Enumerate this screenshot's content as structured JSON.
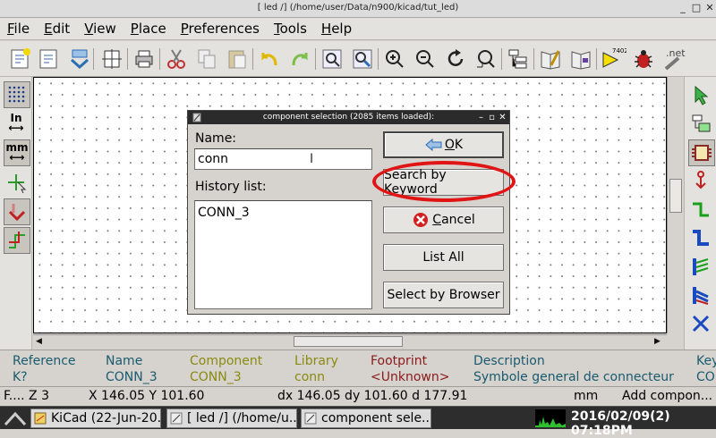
{
  "window": {
    "title": "[ led /] (/home/user/Data/n900/kicad/tut_led)"
  },
  "menubar": [
    {
      "label": "File",
      "mnemonic": "F",
      "rest": "ile"
    },
    {
      "label": "Edit",
      "mnemonic": "E",
      "rest": "dit"
    },
    {
      "label": "View",
      "mnemonic": "V",
      "rest": "iew"
    },
    {
      "label": "Place",
      "mnemonic": "P",
      "rest": "lace"
    },
    {
      "label": "Preferences",
      "mnemonic": "P",
      "rest": "references"
    },
    {
      "label": "Tools",
      "mnemonic": "T",
      "rest": "ools"
    },
    {
      "label": "Help",
      "mnemonic": "H",
      "rest": "elp"
    }
  ],
  "toolbar": {
    "bom_label": "7402",
    "net_label": ".net"
  },
  "left_toolbar": {
    "units_in": "In",
    "units_mm": "mm"
  },
  "dialog": {
    "title": "component selection (2085 items loaded):",
    "name_label": "Name:",
    "name_value": "conn",
    "history_label": "History list:",
    "history_items": [
      "CONN_3"
    ],
    "buttons": {
      "ok": {
        "mnemonic": "O",
        "rest": "K"
      },
      "search_keyword": "Search by Keyword",
      "cancel": {
        "mnemonic": "C",
        "rest": "ancel"
      },
      "list_all": "List All",
      "select_browser": "Select by Browser"
    }
  },
  "message_panel": [
    {
      "header": "Reference",
      "value": "K?",
      "color": "#1a5a6e"
    },
    {
      "header": "Name",
      "value": "CONN_3",
      "color": "#1a5a6e"
    },
    {
      "header": "Component",
      "value": "CONN_3",
      "color": "#8a8a10"
    },
    {
      "header": "Library",
      "value": "conn",
      "color": "#8a8a10"
    },
    {
      "header": "Footprint",
      "value": "<Unknown>",
      "color": "#8a1a1a"
    },
    {
      "header": "Description",
      "value": "Symbole general de connecteur",
      "color": "#1a5a6e"
    },
    {
      "header": "Key",
      "value": "CO",
      "color": "#1a5a6e"
    }
  ],
  "statusbar": {
    "zoom": "F.... Z 3",
    "xy": "X 146.05  Y 101.60",
    "delta": "dx 146.05  dy 101.60  d 177.91",
    "units": "mm",
    "mode": "Add compon..."
  },
  "taskbar": {
    "tasks": [
      "KiCad (22-Jun-20...",
      "[ led /] (/home/u...",
      "component sele..."
    ],
    "clock": "2016/02/09(2) 07:18PM"
  },
  "colors": {
    "highlight": "#e01414",
    "canvas": "#ffffff"
  }
}
